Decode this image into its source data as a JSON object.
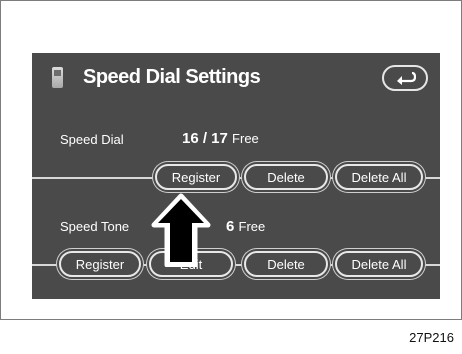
{
  "header": {
    "title": "Speed Dial Settings",
    "phone_icon": "phone-icon",
    "back_icon": "back-arrow-icon"
  },
  "speed_dial": {
    "label": "Speed Dial",
    "count": "16 / 17",
    "free": "Free",
    "buttons": {
      "register": "Register",
      "delete": "Delete",
      "delete_all": "Delete All"
    }
  },
  "speed_tone": {
    "label": "Speed Tone",
    "count": "6",
    "free": "Free",
    "buttons": {
      "register": "Register",
      "edit": "Edit",
      "delete": "Delete",
      "delete_all": "Delete All"
    }
  },
  "pointer_icon": "up-arrow-icon",
  "caption": "27P216"
}
